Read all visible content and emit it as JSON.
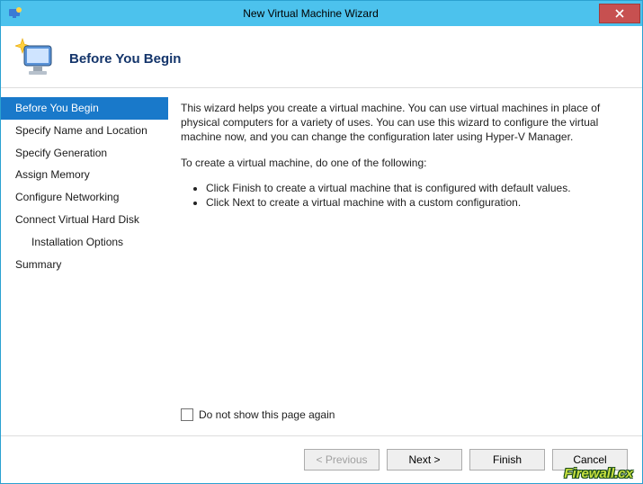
{
  "window": {
    "title": "New Virtual Machine Wizard"
  },
  "header": {
    "title": "Before You Begin"
  },
  "sidebar": {
    "steps": [
      "Before You Begin",
      "Specify Name and Location",
      "Specify Generation",
      "Assign Memory",
      "Configure Networking",
      "Connect Virtual Hard Disk",
      "Installation Options",
      "Summary"
    ]
  },
  "content": {
    "intro": "This wizard helps you create a virtual machine. You can use virtual machines in place of physical computers for a variety of uses. You can use this wizard to configure the virtual machine now, and you can change the configuration later using Hyper-V Manager.",
    "prompt": "To create a virtual machine, do one of the following:",
    "bullets": [
      "Click Finish to create a virtual machine that is configured with default values.",
      "Click Next to create a virtual machine with a custom configuration."
    ],
    "checkbox_label": "Do not show this page again"
  },
  "footer": {
    "previous": "< Previous",
    "next": "Next >",
    "finish": "Finish",
    "cancel": "Cancel"
  },
  "watermark": "Firewall.cx"
}
